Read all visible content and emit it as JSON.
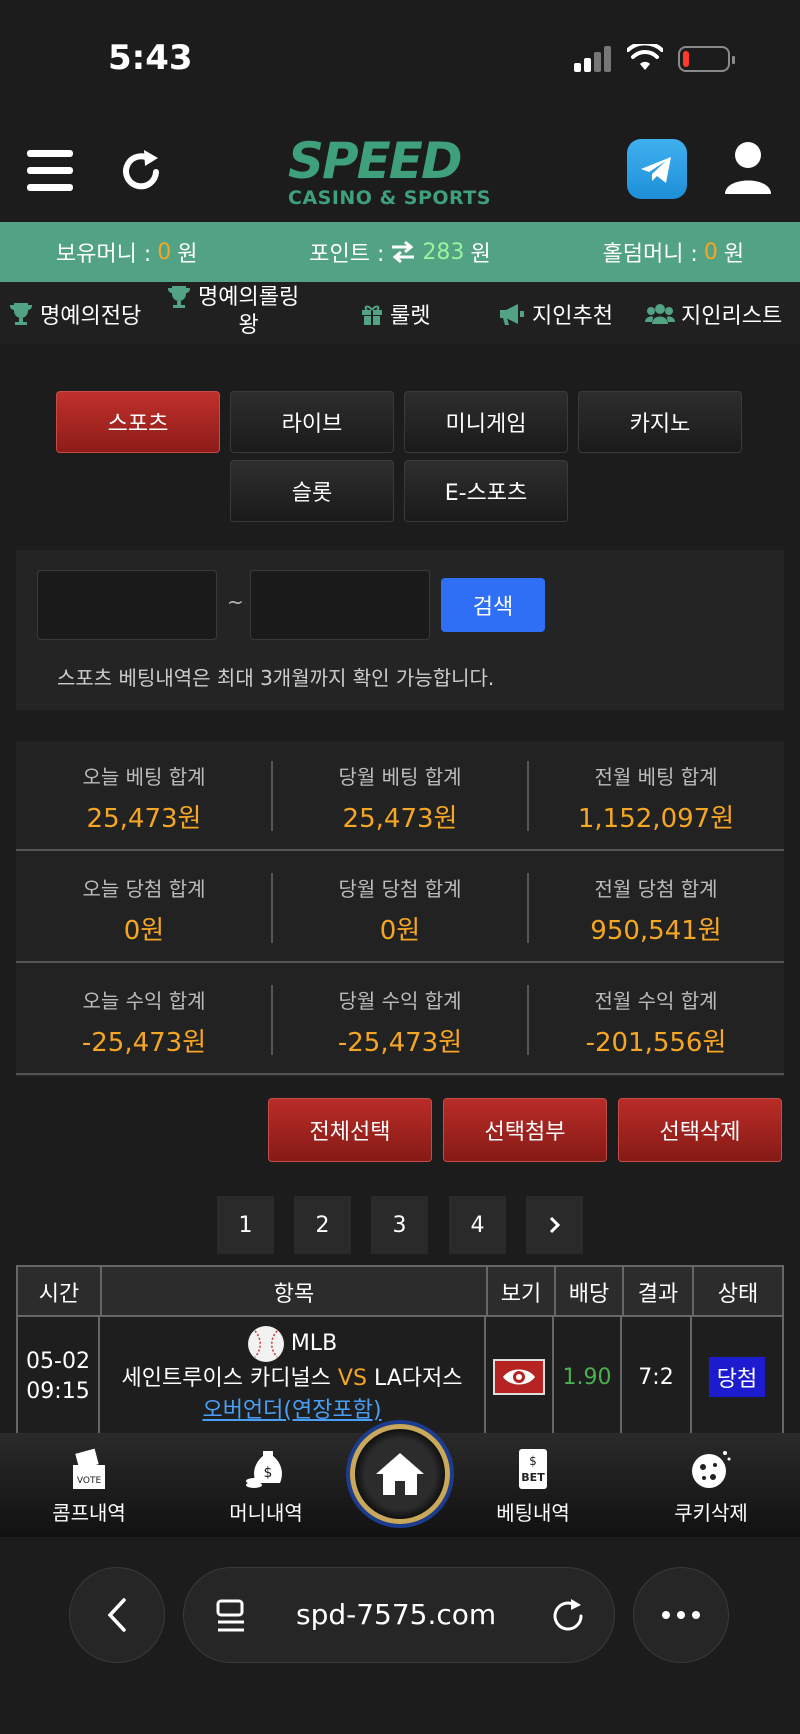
{
  "status_bar": {
    "time": "5:43"
  },
  "header": {
    "logo_main": "SPEED",
    "logo_sub": "CASINO & SPORTS"
  },
  "money_bar": {
    "money_label": "보유머니 :",
    "money_value": "0",
    "money_unit": "원",
    "point_label": "포인트 :",
    "point_value": "283",
    "point_unit": "원",
    "holdem_label": "홀덤머니 :",
    "holdem_value": "0",
    "holdem_unit": "원"
  },
  "nav_row": {
    "items": [
      {
        "label": "명예의전당",
        "icon": "trophy-icon"
      },
      {
        "label": "명예의롤링",
        "label2": "왕",
        "icon": "trophy-icon"
      },
      {
        "label": "룰렛",
        "icon": "gift-icon"
      },
      {
        "label": "지인추천",
        "icon": "megaphone-icon"
      },
      {
        "label": "지인리스트",
        "icon": "users-icon"
      }
    ]
  },
  "tabs": [
    {
      "label": "스포츠",
      "active": true
    },
    {
      "label": "라이브"
    },
    {
      "label": "미니게임"
    },
    {
      "label": "카지노"
    },
    {
      "label": "슬롯"
    },
    {
      "label": "E-스포츠"
    }
  ],
  "search": {
    "tilde": "~",
    "button_label": "검색",
    "note": "스포츠 베팅내역은 최대 3개월까지 확인 가능합니다."
  },
  "stats": [
    [
      {
        "label": "오늘 베팅 합계",
        "value": "25,473원"
      },
      {
        "label": "당월 베팅 합계",
        "value": "25,473원"
      },
      {
        "label": "전월 베팅 합계",
        "value": "1,152,097원"
      }
    ],
    [
      {
        "label": "오늘 당첨 합계",
        "value": "0원"
      },
      {
        "label": "당월 당첨 합계",
        "value": "0원"
      },
      {
        "label": "전월 당첨 합계",
        "value": "950,541원"
      }
    ],
    [
      {
        "label": "오늘 수익 합계",
        "value": "-25,473원"
      },
      {
        "label": "당월 수익 합계",
        "value": "-25,473원"
      },
      {
        "label": "전월 수익 합계",
        "value": "-201,556원"
      }
    ]
  ],
  "actions": {
    "select_all": "전체선택",
    "attach": "선택첨부",
    "delete": "선택삭제"
  },
  "pagination": {
    "pages": [
      "1",
      "2",
      "3",
      "4"
    ],
    "next_icon": "chevron-right-icon"
  },
  "table": {
    "headers": [
      "시간",
      "항목",
      "보기",
      "배당",
      "결과",
      "상태"
    ],
    "rows": [
      {
        "date": "05-02",
        "time": "09:15",
        "league": "MLB",
        "team_home": "세인트루이스 카디널스",
        "vs": "VS",
        "team_away": "LA다저스",
        "market": "오버언더(연장포함)",
        "odds": "1.90",
        "result": "7:2",
        "status": "당첨"
      }
    ]
  },
  "bottom_nav": {
    "items": [
      {
        "label": "콤프내역",
        "icon": "vote-box-icon"
      },
      {
        "label": "머니내역",
        "icon": "money-bag-icon"
      },
      {
        "label": "베팅내역",
        "icon": "bet-slip-icon"
      },
      {
        "label": "쿠키삭제",
        "icon": "cookie-icon"
      }
    ],
    "home_icon": "home-icon"
  },
  "browser": {
    "url": "spd-7575.com"
  },
  "colors": {
    "accent_green": "#52a284",
    "accent_red": "#b92c28",
    "value_orange": "#f5a623",
    "search_blue": "#2e6ff5",
    "status_blue": "#1c1bd0"
  }
}
